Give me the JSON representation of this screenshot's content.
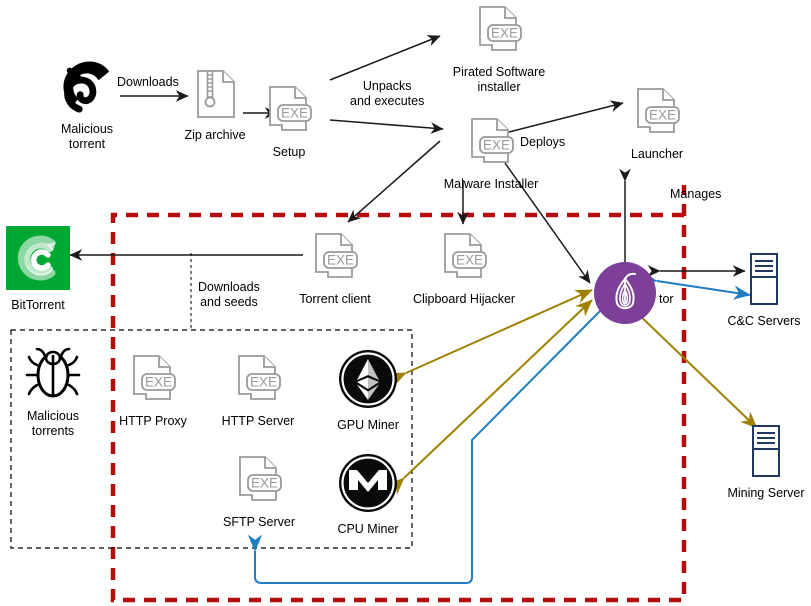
{
  "diagram": {
    "title": "Malicious torrent malware infection chain",
    "colors": {
      "trust_boundary_red": "#b50d0d",
      "inner_dashed_black": "#000000",
      "tor_purple": "#7d3f98",
      "bittorrent_green": "#00a733",
      "server_navy": "#1f3864",
      "miner_gold": "#a08000",
      "tor_blue": "#1f7ec2",
      "file_gray": "#9a9a9a",
      "arrow_black": "#1a1a1a"
    },
    "nodes": [
      {
        "id": "malicious-torrent",
        "label": "Malicious\ntorrent",
        "icon": "magnet-icon"
      },
      {
        "id": "zip-archive",
        "label": "Zip archive",
        "icon": "zip-file-icon"
      },
      {
        "id": "setup",
        "label": "Setup",
        "icon": "exe-file-icon"
      },
      {
        "id": "pirated-software-installer",
        "label": "Pirated Software\ninstaller",
        "icon": "exe-file-icon"
      },
      {
        "id": "malware-installer",
        "label": "Malware Installer",
        "icon": "exe-file-icon"
      },
      {
        "id": "launcher",
        "label": "Launcher",
        "icon": "exe-file-icon"
      },
      {
        "id": "bittorrent",
        "label": "BitTorrent",
        "icon": "bittorrent-logo-icon"
      },
      {
        "id": "torrent-client",
        "label": "Torrent client",
        "icon": "exe-file-icon"
      },
      {
        "id": "clipboard-hijacker",
        "label": "Clipboard Hijacker",
        "icon": "exe-file-icon"
      },
      {
        "id": "tor",
        "label": "tor",
        "icon": "tor-onion-icon"
      },
      {
        "id": "cc-servers",
        "label": "C&C Servers",
        "icon": "server-icon"
      },
      {
        "id": "mining-server",
        "label": "Mining Server",
        "icon": "server-icon"
      },
      {
        "id": "malicious-torrents",
        "label": "Malicious\ntorrents",
        "icon": "bug-icon"
      },
      {
        "id": "http-proxy",
        "label": "HTTP Proxy",
        "icon": "exe-file-icon"
      },
      {
        "id": "http-server",
        "label": "HTTP Server",
        "icon": "exe-file-icon"
      },
      {
        "id": "gpu-miner",
        "label": "GPU Miner",
        "icon": "ethereum-logo-icon"
      },
      {
        "id": "sftp-server",
        "label": "SFTP Server",
        "icon": "exe-file-icon"
      },
      {
        "id": "cpu-miner",
        "label": "CPU Miner",
        "icon": "monero-logo-icon"
      }
    ],
    "edge_labels": [
      {
        "id": "downloads",
        "text": "Downloads"
      },
      {
        "id": "unpacks-and-executes",
        "text": "Unpacks\nand executes"
      },
      {
        "id": "deploys",
        "text": "Deploys"
      },
      {
        "id": "manages",
        "text": "Manages"
      },
      {
        "id": "downloads-and-seeds",
        "text": "Downloads\nand seeds"
      }
    ]
  }
}
